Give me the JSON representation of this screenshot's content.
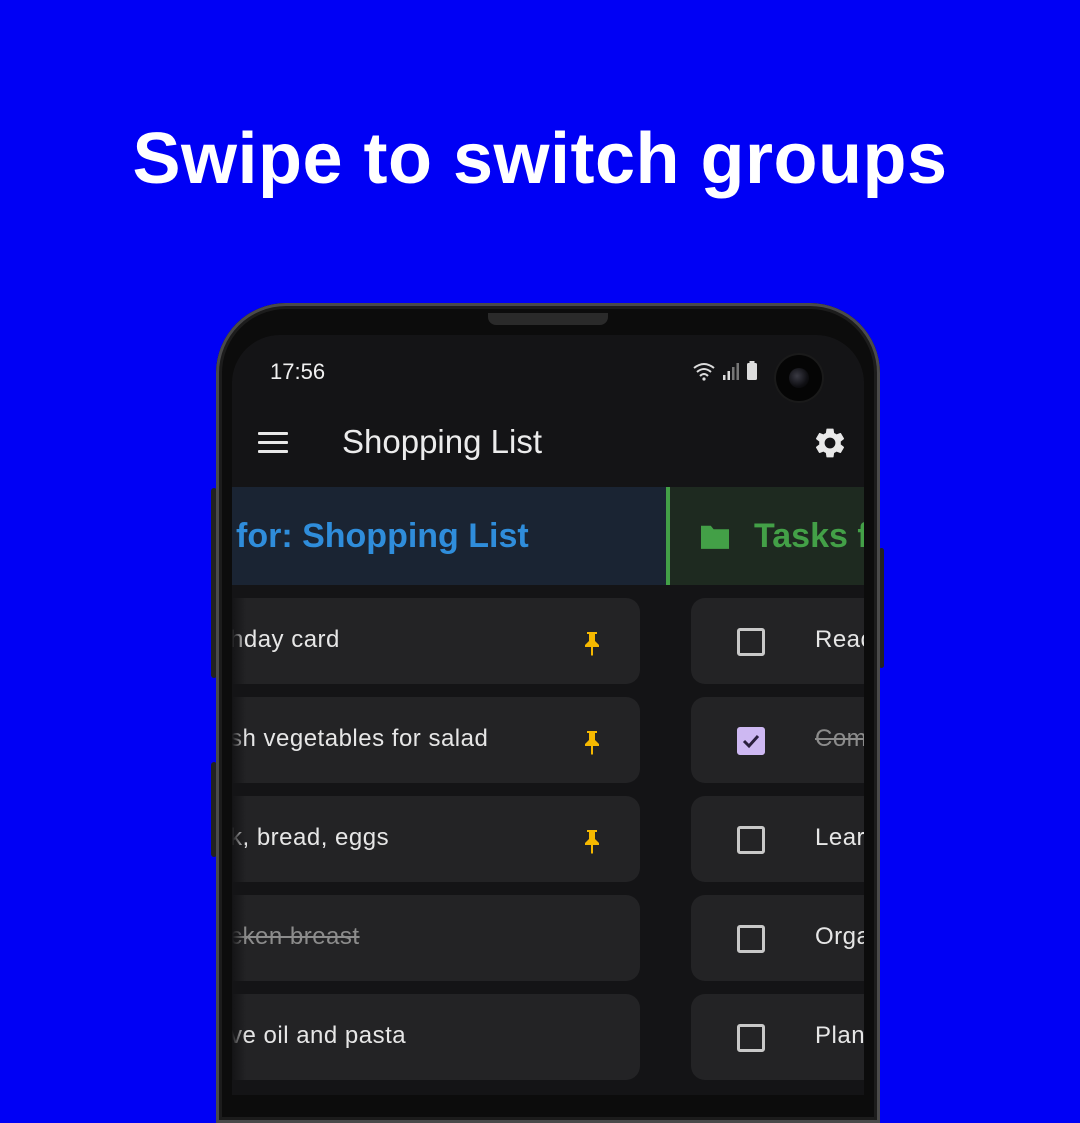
{
  "headline": "Swipe to switch groups",
  "status_bar": {
    "time": "17:56"
  },
  "app_bar": {
    "title": "Shopping List"
  },
  "groups": {
    "current_label": "for: Shopping List",
    "next_label": "Tasks f"
  },
  "shopping_items": [
    {
      "text": "hday card",
      "pinned": true,
      "done": false
    },
    {
      "text": "sh vegetables for salad",
      "pinned": true,
      "done": false
    },
    {
      "text": "k, bread, eggs",
      "pinned": true,
      "done": false
    },
    {
      "text": "cken breast",
      "pinned": false,
      "done": true
    },
    {
      "text": "ve oil and pasta",
      "pinned": false,
      "done": false
    }
  ],
  "task_items": [
    {
      "text": "Reac",
      "checked": false
    },
    {
      "text": "Com",
      "checked": true
    },
    {
      "text": "Lear",
      "checked": false
    },
    {
      "text": "Orga",
      "checked": false
    },
    {
      "text": "Plan",
      "checked": false
    }
  ],
  "colors": {
    "background": "#0000f5",
    "group_blue": "#2f8ddb",
    "group_green": "#43a047",
    "pin": "#f5b800",
    "checkbox_checked": "#cdb8f2"
  },
  "icons": [
    "menu-icon",
    "gear-icon",
    "folder-icon",
    "pin-icon",
    "checkbox-icon",
    "wifi-icon",
    "signal-icon",
    "battery-icon",
    "camera"
  ]
}
